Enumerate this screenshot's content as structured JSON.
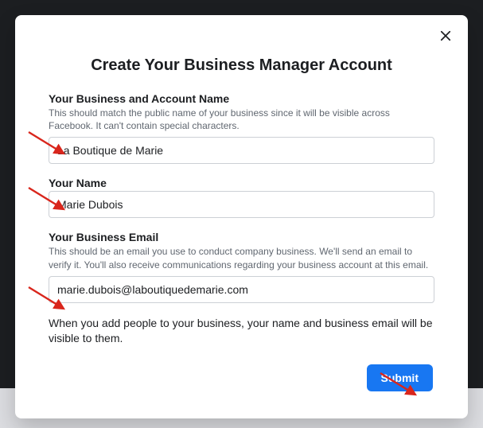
{
  "modal": {
    "title": "Create Your Business Manager Account"
  },
  "fields": {
    "businessName": {
      "label": "Your Business and Account Name",
      "hint": "This should match the public name of your business since it will be visible across Facebook. It can't contain special characters.",
      "value": "La Boutique de Marie"
    },
    "yourName": {
      "label": "Your Name",
      "value": "Marie Dubois"
    },
    "businessEmail": {
      "label": "Your Business Email",
      "hint": "This should be an email you use to conduct company business. We'll send an email to verify it. You'll also receive communications regarding your business account at this email.",
      "value": "marie.dubois@laboutiquedemarie.com"
    }
  },
  "disclosure": "When you add people to your business, your name and business email will be visible to them.",
  "buttons": {
    "submit": "Submit"
  }
}
